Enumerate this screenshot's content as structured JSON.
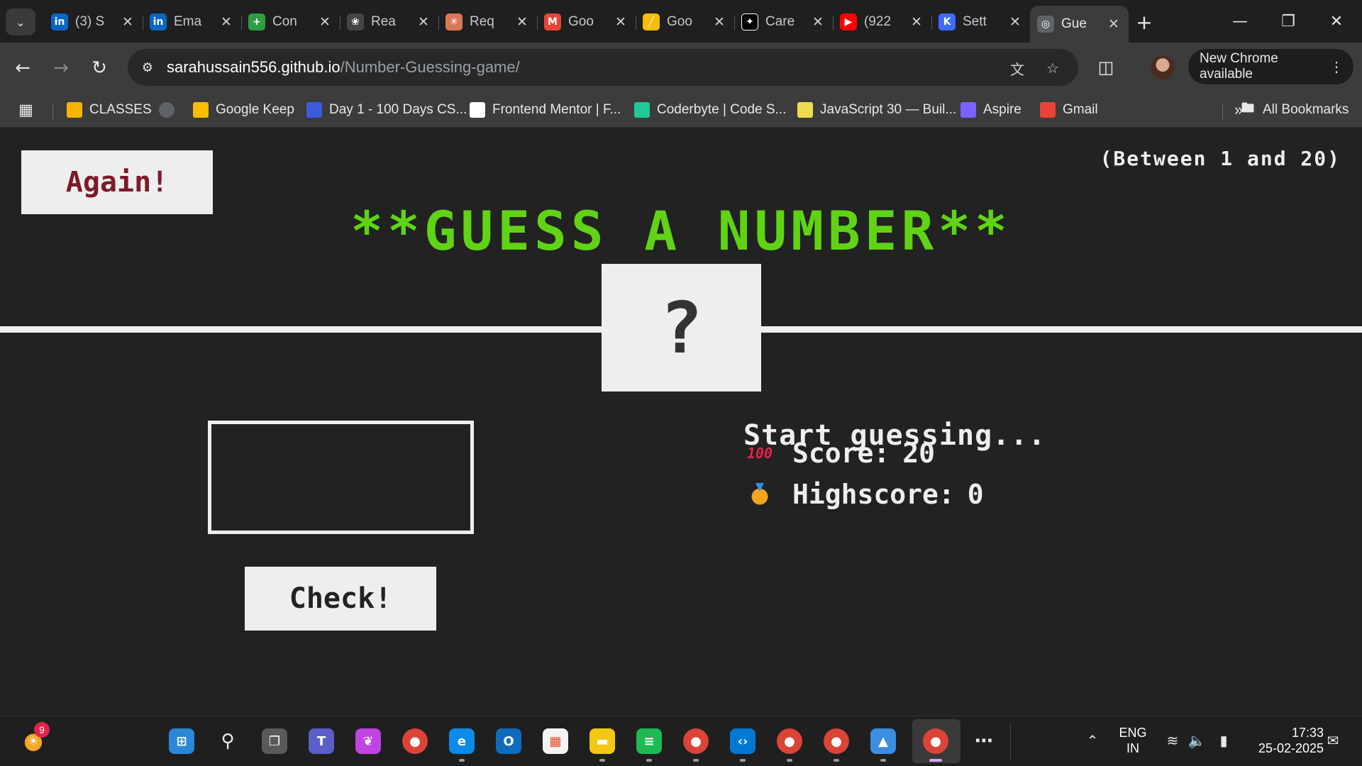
{
  "browser": {
    "tabs": [
      {
        "title": "(3) S",
        "icon": "linkedin-icon",
        "color": "#0a66c2",
        "glyph": "in"
      },
      {
        "title": "Ema",
        "icon": "linkedin-icon",
        "color": "#0a66c2",
        "glyph": "in"
      },
      {
        "title": "Con",
        "icon": "plus-circle-icon",
        "color": "#2e9e44",
        "glyph": "+"
      },
      {
        "title": "Rea",
        "icon": "openai-icon",
        "color": "#444444",
        "glyph": "❀"
      },
      {
        "title": "Req",
        "icon": "claude-icon",
        "color": "#d97757",
        "glyph": "✳"
      },
      {
        "title": "Goo",
        "icon": "gmail-icon",
        "color": "#ea4335",
        "glyph": "M"
      },
      {
        "title": "Goo",
        "icon": "google-ads-icon",
        "color": "#fbbc04",
        "glyph": "╱"
      },
      {
        "title": "Care",
        "icon": "gemini-icon",
        "color": "#ffffff",
        "glyph": "✦"
      },
      {
        "title": "(922",
        "icon": "youtube-icon",
        "color": "#ff0000",
        "glyph": "▶"
      },
      {
        "title": "Sett",
        "icon": "kotlin-icon",
        "color": "#3d6bff",
        "glyph": "K"
      },
      {
        "title": "Gue",
        "icon": "globe-icon",
        "color": "#5f6368",
        "glyph": "◎",
        "active": true
      }
    ],
    "url_host": "sarahussain556.github.io",
    "url_path": "/Number-Guessing-game/",
    "update_chip": "New Chrome available",
    "bookmarks": [
      {
        "label": "CLASSES",
        "icon": "classroom-icon",
        "color": "#f4b400"
      },
      {
        "label": "",
        "icon": "globe-icon",
        "color": "#5f6368"
      },
      {
        "label": "Google Keep",
        "icon": "keep-icon",
        "color": "#fbbc04"
      },
      {
        "label": "Day 1 - 100 Days CS...",
        "icon": "course-icon",
        "color": "#3b5bdb"
      },
      {
        "label": "Frontend Mentor | F...",
        "icon": "frontend-mentor-icon",
        "color": "#ffffff"
      },
      {
        "label": "Coderbyte | Code S...",
        "icon": "coderbyte-icon",
        "color": "#20c997"
      },
      {
        "label": "JavaScript 30 — Buil...",
        "icon": "js30-icon",
        "color": "#f0db4f"
      },
      {
        "label": "Aspire",
        "icon": "aspire-icon",
        "color": "#7b61ff"
      },
      {
        "label": "Gmail",
        "icon": "gmail-icon",
        "color": "#ea4335"
      }
    ],
    "all_bookmarks": "All Bookmarks"
  },
  "game": {
    "again_label": "Again!",
    "range_hint": "(Between 1 and 20)",
    "title": "**GUESS A NUMBER**",
    "secret": "?",
    "guess_value": "",
    "check_label": "Check!",
    "message": "Start guessing...",
    "score_label": "Score: ",
    "score": "20",
    "highscore_label": "Highscore: ",
    "highscore": "0",
    "colors": {
      "background": "#222222",
      "title": "#60d414",
      "again_text": "#7d1a2a",
      "panel": "#eeeeee"
    }
  },
  "taskbar": {
    "weather_badge": "9",
    "apps": [
      {
        "name": "start-icon"
      },
      {
        "name": "search-icon"
      },
      {
        "name": "task-view-icon"
      },
      {
        "name": "teams-icon"
      },
      {
        "name": "copilot-icon"
      },
      {
        "name": "chrome-icon"
      },
      {
        "name": "edge-icon"
      },
      {
        "name": "outlook-icon"
      },
      {
        "name": "store-icon"
      },
      {
        "name": "file-explorer-icon"
      },
      {
        "name": "spotify-icon"
      },
      {
        "name": "chrome-icon"
      },
      {
        "name": "vscode-icon"
      },
      {
        "name": "chrome-icon"
      },
      {
        "name": "chrome-icon"
      },
      {
        "name": "photos-icon"
      },
      {
        "name": "chrome-icon"
      },
      {
        "name": "more-icon"
      }
    ],
    "lang_1": "ENG",
    "lang_2": "IN",
    "time": "17:33",
    "date": "25-02-2025"
  }
}
